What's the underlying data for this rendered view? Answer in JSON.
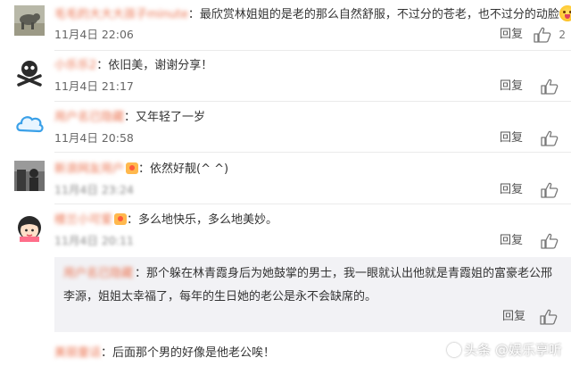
{
  "comments": [
    {
      "username": "毛毛的大大大孩子minute",
      "text": "最欣赏林姐姐的是老的那么自然舒服，不过分的苍老，也不过分的动脸",
      "emoji": "face-with-tongue-emoji",
      "time": "11月4日 22:06",
      "reply_label": "回复",
      "like_count": "2"
    },
    {
      "username": "小乐乐2",
      "text": "依旧美，谢谢分享！",
      "time": "11月4日 21:17",
      "reply_label": "回复"
    },
    {
      "username": "用户名已隐藏",
      "text": "又年轻了一岁",
      "time": "11月4日 20:58",
      "reply_label": "回复"
    },
    {
      "username": "新浪网友用户",
      "text": "依然好靓(^ ^)",
      "time": "11月4日 23:24",
      "reply_label": "回复"
    },
    {
      "username": "楼兰小可爱",
      "text": "多么地快乐，多么地美妙。",
      "time": "11月4日 20:11",
      "reply_label": "回复"
    }
  ],
  "sub_reply": {
    "username": "用户名已隐藏",
    "text": "那个躲在林青霞身后为她鼓掌的男士，我一眼就认出他就是青霞姐的富豪老公邢李源，姐姐太幸福了，每年的生日她的老公是永不会缺席的。",
    "reply_label": "回复"
  },
  "last_comment": {
    "username": "美丽童话",
    "text": "后面那个男的好像是他老公唉！"
  },
  "watermark": "头条 @娱乐享听",
  "colors": {
    "username": "#eb7350",
    "text": "#333333",
    "meta": "#666666",
    "sub_bg": "#f2f2f5"
  }
}
